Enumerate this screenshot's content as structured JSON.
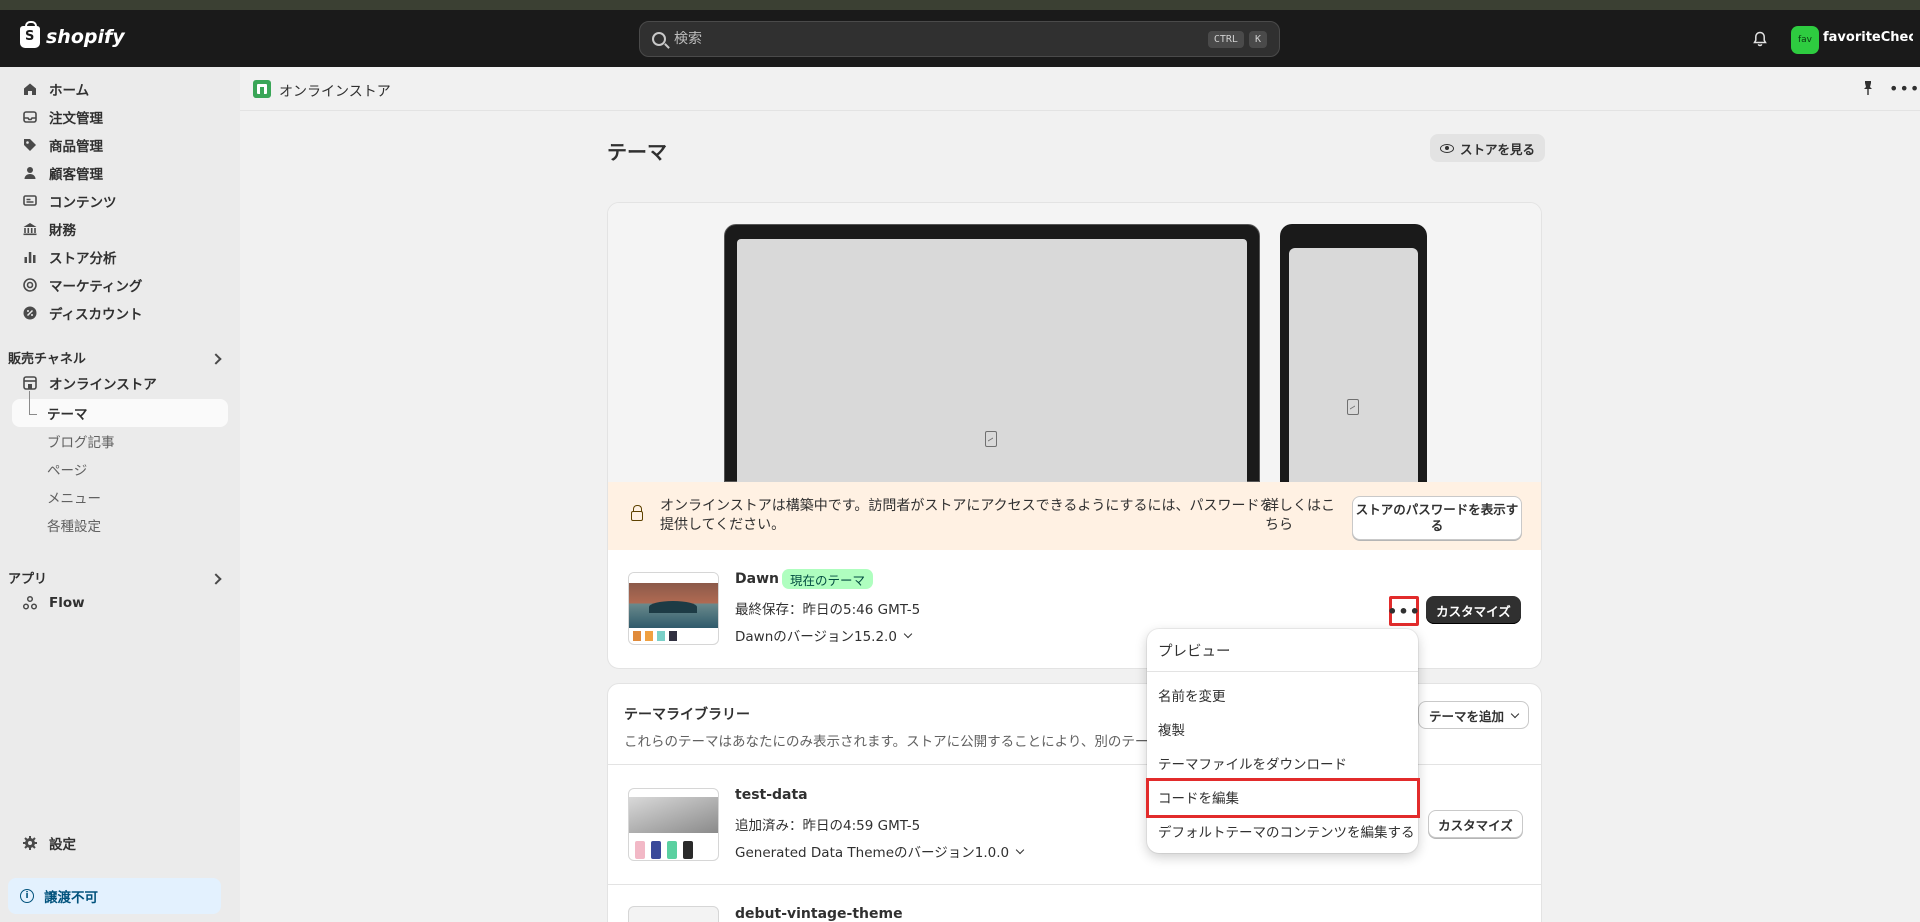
{
  "topbar": {
    "brand": "shopify",
    "search_placeholder": "検索",
    "shortcut_ctrl": "CTRL",
    "shortcut_k": "K",
    "store_avatar": "fav",
    "store_name": "favoriteCheck"
  },
  "sidebar": {
    "items": [
      {
        "label": "ホーム",
        "icon": "home-icon"
      },
      {
        "label": "注文管理",
        "icon": "inbox-icon"
      },
      {
        "label": "商品管理",
        "icon": "tag-icon"
      },
      {
        "label": "顧客管理",
        "icon": "person-icon"
      },
      {
        "label": "コンテンツ",
        "icon": "content-icon"
      },
      {
        "label": "財務",
        "icon": "bank-icon"
      },
      {
        "label": "ストア分析",
        "icon": "bar-chart-icon"
      },
      {
        "label": "マーケティング",
        "icon": "target-icon"
      },
      {
        "label": "ディスカウント",
        "icon": "discount-icon"
      }
    ],
    "sales_channels_label": "販売チャネル",
    "online_store": "オンラインストア",
    "sub_items": [
      "テーマ",
      "ブログ記事",
      "ページ",
      "メニュー",
      "各種設定"
    ],
    "apps_label": "アプリ",
    "flow": "Flow",
    "settings": "設定",
    "notice": "譲渡不可"
  },
  "crumb": {
    "title": "オンラインストア"
  },
  "page": {
    "title": "テーマ",
    "view_store": "ストアを見る"
  },
  "current_theme": {
    "warning": "オンラインストアは構築中です。訪問者がストアにアクセスできるようにするには、パスワードを提供してください。",
    "learn_more": "詳しくはこちら",
    "show_password": "ストアのパスワードを表示する",
    "name": "Dawn",
    "badge": "現在のテーマ",
    "saved": "最終保存：昨日の5:46 GMT-5",
    "version": "Dawnのバージョン15.2.0",
    "more": "•••",
    "customize": "カスタマイズ"
  },
  "library": {
    "title": "テーマライブラリー",
    "description": "これらのテーマはあなたにのみ表示されます。ストアに公開することにより、別のテーマに",
    "add_theme": "テーマを追加",
    "themes": [
      {
        "name": "test-data",
        "added": "追加済み：昨日の4:59 GMT-5",
        "version": "Generated Data Themeのバージョン1.0.0",
        "customize": "カスタマイズ"
      },
      {
        "name": "debut-vintage-theme"
      }
    ]
  },
  "menu": {
    "items": [
      "プレビュー",
      "名前を変更",
      "複製",
      "テーマファイルをダウンロード",
      "コードを編集",
      "デフォルトテーマのコンテンツを編集する"
    ]
  },
  "colors": {
    "topbar": "#1a1a1a",
    "badge_bg": "#affebf",
    "warning_bg": "#fff1e3",
    "highlight": "#e22b2b"
  }
}
